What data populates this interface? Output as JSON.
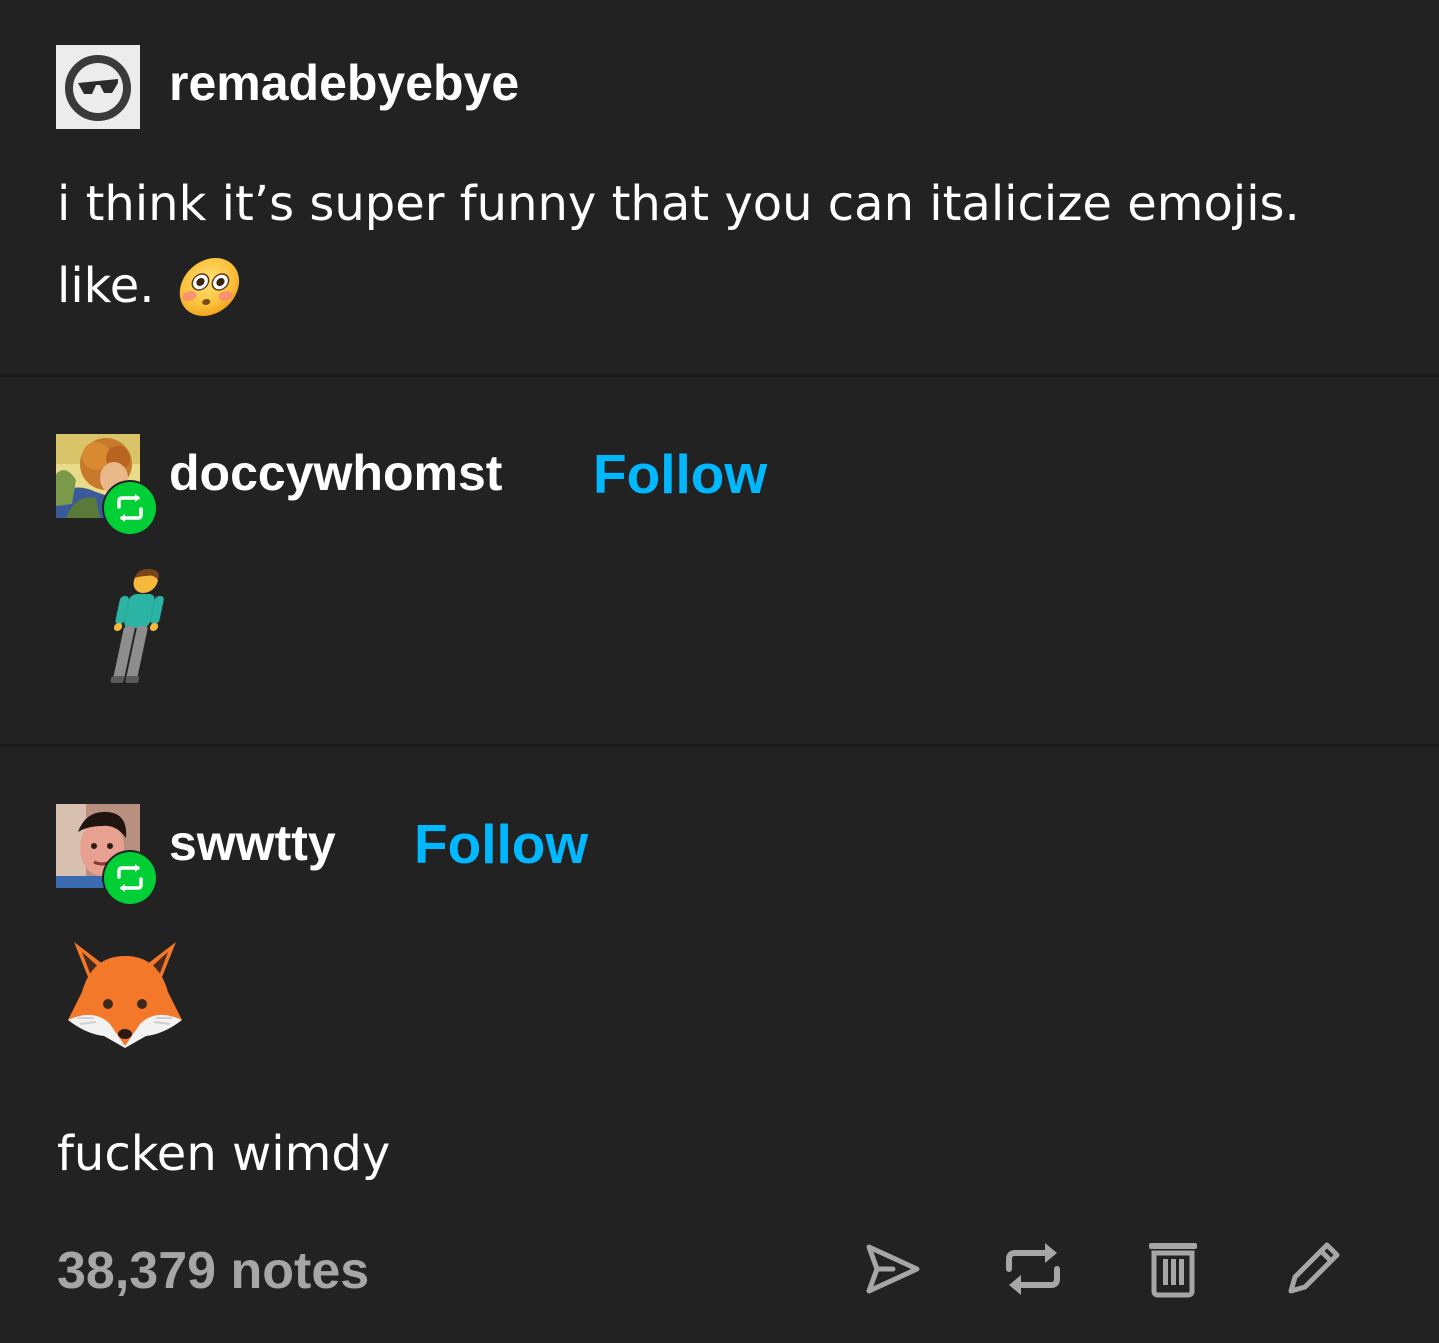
{
  "original_post": {
    "username": "remadebyebye",
    "text_line1": "i think it’s super funny that you can italicize emojis.",
    "text_line2": "like.",
    "emoji_icon": "flushed-face-emoji"
  },
  "reblogs": [
    {
      "username": "doccywhomst",
      "follow_label": "Follow",
      "content_icon": "person-standing-emoji"
    },
    {
      "username": "swwtty",
      "follow_label": "Follow",
      "content_icon": "fox-face-emoji",
      "text": "fucken wimdy"
    }
  ],
  "footer": {
    "notes": "38,379 notes",
    "actions": [
      "share-icon",
      "reblog-icon",
      "delete-icon",
      "edit-icon"
    ]
  },
  "colors": {
    "background": "#222222",
    "follow": "#00b8ff",
    "reblog_badge": "#00cf35",
    "notes": "#a6a6a6"
  }
}
